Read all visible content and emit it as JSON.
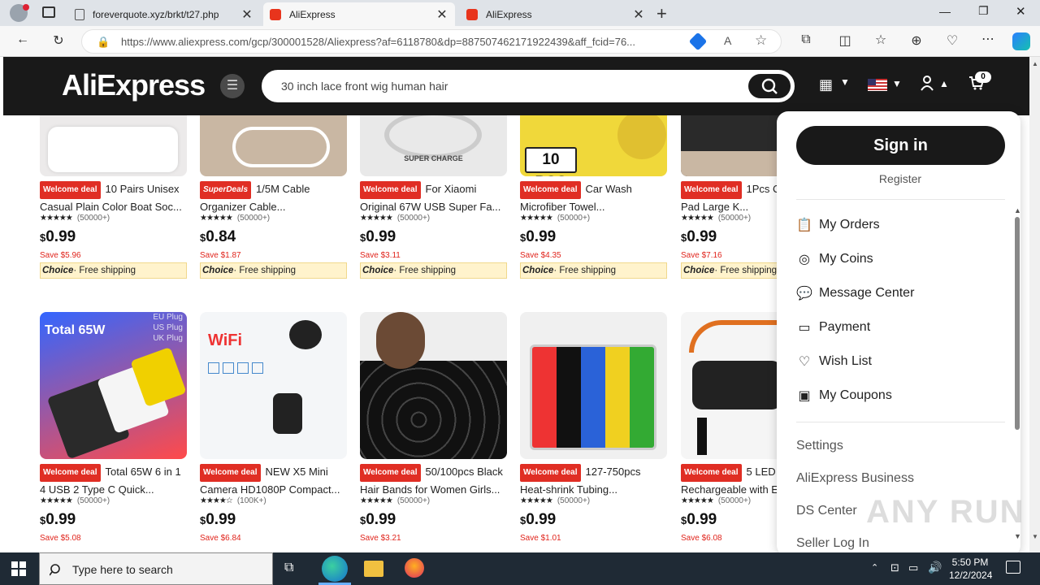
{
  "browser": {
    "tabs": [
      {
        "title": "foreverquote.xyz/brkt/t27.php",
        "active": false
      },
      {
        "title": "AliExpress",
        "active": true
      },
      {
        "title": "AliExpress",
        "active": false
      }
    ],
    "new_tab": "+",
    "url": "https://www.aliexpress.com/gcp/300001528/Aliexpress?af=6118780&dp=887507462171922439&aff_fcid=76...",
    "window_controls": [
      "minimize",
      "restore",
      "close"
    ]
  },
  "header": {
    "logo": "AliExpress",
    "search_query": "30 inch lace front wig human hair",
    "cart_count": "0"
  },
  "products_row1": [
    {
      "badge": "Welcome deal",
      "badge_type": "welcome",
      "name": "10 Pairs Unisex Casual Plain Color Boat Soc...",
      "reviews": "(50000+)",
      "cur": "$",
      "price": "0.99",
      "save": "Save $5.96",
      "choice": "Choice",
      "shipping": "· Free shipping"
    },
    {
      "badge": "SuperDeals",
      "badge_type": "super",
      "name": "1/5M Cable Organizer Cable...",
      "reviews": "(50000+)",
      "cur": "$",
      "price": "0.84",
      "save": "Save $1.87",
      "choice": "Choice",
      "shipping": "· Free shipping"
    },
    {
      "badge": "Welcome deal",
      "badge_type": "welcome",
      "name": "For Xiaomi Original 67W USB Super Fa...",
      "reviews": "(50000+)",
      "cur": "$",
      "price": "0.99",
      "save": "Save $3.11",
      "choice": "Choice",
      "shipping": "· Free shipping"
    },
    {
      "badge": "Welcome deal",
      "badge_type": "welcome",
      "name": "Car Wash Microfiber Towel...",
      "reviews": "(50000+)",
      "cur": "$",
      "price": "0.99",
      "save": "Save $4.35",
      "choice": "Choice",
      "shipping": "· Free shipping"
    },
    {
      "badge": "Welcome deal",
      "badge_type": "welcome",
      "name": "1Pcs C... Mouse Pad Large K...",
      "reviews": "(50000+)",
      "cur": "$",
      "price": "0.99",
      "save": "Save $7.16",
      "choice": "Choice",
      "shipping": "· Free shipping"
    }
  ],
  "products_row2": [
    {
      "badge": "Welcome deal",
      "name": "Total 65W 6 in 1 4 USB 2 Type C Quick...",
      "reviews": "(50000+)",
      "cur": "$",
      "price": "0.99",
      "save": "Save $5.08"
    },
    {
      "badge": "Welcome deal",
      "name": "NEW X5 Mini Camera HD1080P Compact...",
      "reviews": "(100K+)",
      "cur": "$",
      "price": "0.99",
      "save": "Save $6.84"
    },
    {
      "badge": "Welcome deal",
      "name": "50/100pcs Black Hair Bands for Women Girls...",
      "reviews": "(50000+)",
      "cur": "$",
      "price": "0.99",
      "save": "Save $3.21"
    },
    {
      "badge": "Welcome deal",
      "name": "127-750pcs Heat-shrink Tubing...",
      "reviews": "(50000+)",
      "cur": "$",
      "price": "0.99",
      "save": "Save $1.01"
    },
    {
      "badge": "Welcome deal",
      "name": "5 LED Rechargeable with E...",
      "reviews": "(50000+)",
      "cur": "$",
      "price": "0.99",
      "save": "Save $6.08"
    }
  ],
  "image_text": {
    "p1_3": "SUPER CHARGE",
    "p1_4": "10 PCS",
    "p2_1_title": "Total 65W",
    "p2_1_plugs": "EU Plug US Plug UK Plug",
    "p2_2": "WiFi"
  },
  "dropdown": {
    "sign_in": "Sign in",
    "register": "Register",
    "items": [
      {
        "label": "My Orders",
        "icon": "clipboard-icon"
      },
      {
        "label": "My Coins",
        "icon": "coin-icon"
      },
      {
        "label": "Message Center",
        "icon": "message-icon"
      },
      {
        "label": "Payment",
        "icon": "card-icon"
      },
      {
        "label": "Wish List",
        "icon": "heart-icon"
      },
      {
        "label": "My Coupons",
        "icon": "coupon-icon"
      }
    ],
    "links": [
      "Settings",
      "AliExpress Business",
      "DS Center",
      "Seller Log In"
    ]
  },
  "taskbar": {
    "search_placeholder": "Type here to search",
    "time": "5:50 PM",
    "date": "12/2/2024"
  },
  "watermark": "ANY RUN",
  "colors": {
    "accent": "#e02e24",
    "header_bg": "#191919",
    "choice_bg": "#fff3cc"
  }
}
